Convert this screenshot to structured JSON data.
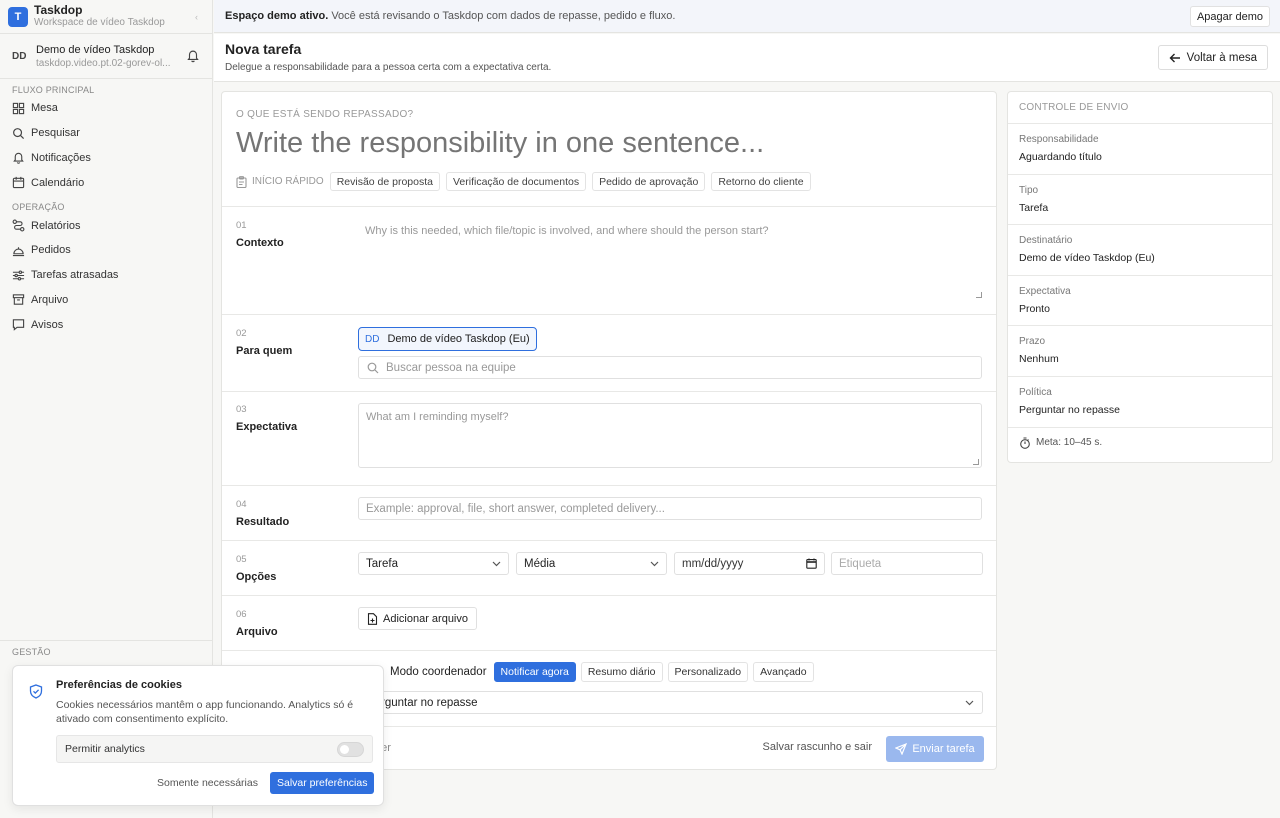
{
  "workspace": {
    "logo": "T",
    "name": "Taskdop",
    "subtitle": "Workspace de vídeo Taskdop",
    "collapse_icon": "chevron-left-icon"
  },
  "user": {
    "initials": "DD",
    "name": "Demo de vídeo Taskdop",
    "subtitle": "taskdop.video.pt.02-gorev-ol...",
    "bell_icon": "bell-icon"
  },
  "sidebar": {
    "section_main": "FLUXO PRINCIPAL",
    "main_items": [
      {
        "label": "Mesa",
        "icon": "grid-icon"
      },
      {
        "label": "Pesquisar",
        "icon": "search-icon"
      },
      {
        "label": "Notificações",
        "icon": "bell-icon"
      },
      {
        "label": "Calendário",
        "icon": "calendar-icon"
      }
    ],
    "section_ops": "OPERAÇÃO",
    "ops_items": [
      {
        "label": "Relatórios",
        "icon": "route-icon"
      },
      {
        "label": "Pedidos",
        "icon": "bell-service-icon"
      },
      {
        "label": "Tarefas atrasadas",
        "icon": "sliders-icon"
      },
      {
        "label": "Arquivo",
        "icon": "archive-icon"
      },
      {
        "label": "Avisos",
        "icon": "message-icon"
      }
    ],
    "section_mgmt": "GESTÃO"
  },
  "banner": {
    "bold": "Espaço demo ativo.",
    "text": "Você está revisando o Taskdop com dados de repasse, pedido e fluxo.",
    "button": "Apagar demo"
  },
  "header": {
    "title": "Nova tarefa",
    "subtitle": "Delegue a responsabilidade para a pessoa certa com a expectativa certa.",
    "back_button": "Voltar à mesa"
  },
  "form": {
    "question_label": "O QUE ESTÁ SENDO REPASSADO?",
    "title_placeholder": "Write the responsibility in one sentence...",
    "quick_start_label": "INÍCIO RÁPIDO",
    "quick_chips": [
      "Revisão de proposta",
      "Verificação de documentos",
      "Pedido de aprovação",
      "Retorno do cliente"
    ],
    "context": {
      "num": "01",
      "label": "Contexto",
      "placeholder": "Why is this needed, which file/topic is involved, and where should the person start?"
    },
    "recipient": {
      "num": "02",
      "label": "Para quem",
      "selected_initials": "DD",
      "selected_name": "Demo de vídeo Taskdop (Eu)",
      "search_placeholder": "Buscar pessoa na equipe"
    },
    "expectation": {
      "num": "03",
      "label": "Expectativa",
      "placeholder": "What am I reminding myself?"
    },
    "result": {
      "num": "04",
      "label": "Resultado",
      "placeholder": "Example: approval, file, short answer, completed delivery..."
    },
    "options": {
      "num": "05",
      "label": "Opções",
      "type": "Tarefa",
      "priority": "Média",
      "date_placeholder": "mm/dd/yyyy",
      "tag_placeholder": "Etiqueta"
    },
    "file": {
      "num": "06",
      "label": "Arquivo",
      "button": "Adicionar arquivo"
    },
    "mode": {
      "label": "Modo coordenador",
      "chips": [
        "Notificar agora",
        "Resumo diário",
        "Personalizado",
        "Avançado"
      ],
      "active": "Notificar agora",
      "policy": "rguntar no repasse"
    },
    "footer": {
      "later": "nter",
      "save": "Salvar rascunho e sair",
      "send": "Enviar tarefa"
    }
  },
  "panel": {
    "header": "CONTROLE DE ENVIO",
    "items": [
      {
        "key": "Responsabilidade",
        "value": "Aguardando título"
      },
      {
        "key": "Tipo",
        "value": "Tarefa"
      },
      {
        "key": "Destinatário",
        "value": "Demo de vídeo Taskdop (Eu)"
      },
      {
        "key": "Expectativa",
        "value": "Pronto"
      },
      {
        "key": "Prazo",
        "value": "Nenhum"
      },
      {
        "key": "Política",
        "value": "Perguntar no repasse"
      }
    ],
    "meta": "Meta: 10–45 s."
  },
  "cookies": {
    "title": "Preferências de cookies",
    "text": "Cookies necessários mantêm o app funcionando. Analytics só é ativado com consentimento explícito.",
    "toggle_label": "Permitir analytics",
    "analytics_enabled": false,
    "only_necessary": "Somente necessárias",
    "save": "Salvar preferências"
  },
  "colors": {
    "accent": "#2f6fde",
    "send_disabled": "#9ab8ee"
  }
}
